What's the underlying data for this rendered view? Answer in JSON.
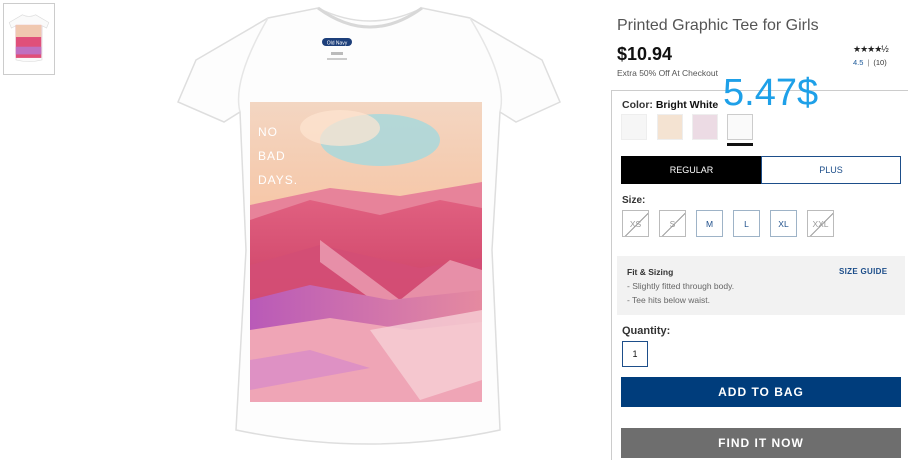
{
  "product": {
    "title": "Printed Graphic Tee for Girls",
    "price": "$10.94",
    "promo": "Extra 50% Off At Checkout",
    "stars": "★★★★½",
    "rating_value": "4.5",
    "rating_count": "(10)",
    "overlay_price": "5.47$",
    "graphic_text": [
      "NO",
      "BAD",
      "DAYS."
    ],
    "tag_brand": "Old Navy"
  },
  "color": {
    "label": "Color:",
    "value": "Bright White",
    "swatches": [
      "#f6f6f6",
      "#f4e3d2",
      "#ecdbe4",
      "#fafafa"
    ]
  },
  "fit_options": {
    "regular": "REGULAR",
    "plus": "PLUS"
  },
  "sizes": {
    "label": "Size:",
    "options": [
      "XS",
      "S",
      "M",
      "L",
      "XL",
      "XXL"
    ]
  },
  "fit_sizing": {
    "title": "Fit & Sizing",
    "guide": "SIZE GUIDE",
    "lines": [
      "- Slightly fitted through body.",
      "- Tee hits below waist."
    ]
  },
  "quantity": {
    "label": "Quantity:",
    "value": "1"
  },
  "actions": {
    "add_to_bag": "ADD TO BAG",
    "find_it_now": "FIND IT NOW"
  },
  "colors": {
    "accent": "#003d7c",
    "overlay": "#1ea0e8",
    "secondary_button": "#6e6e6e"
  }
}
